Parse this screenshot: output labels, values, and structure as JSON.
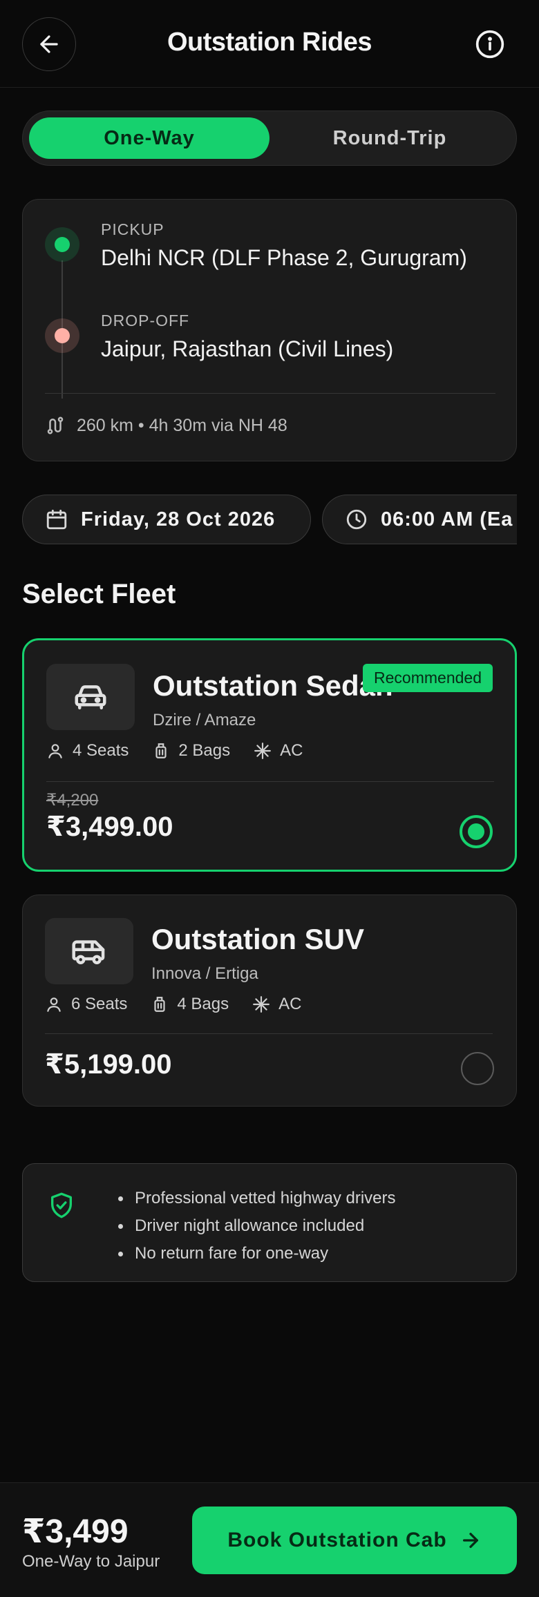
{
  "header": {
    "title": "Outstation Rides",
    "back_icon": "arrow-left-icon",
    "info_icon": "info-icon"
  },
  "trip_type": {
    "options": [
      "One-Way",
      "Round-Trip"
    ],
    "selected": "One-Way"
  },
  "route": {
    "pickup_label": "PICKUP",
    "pickup_value": "Delhi NCR (DLF Phase 2, Gurugram)",
    "dropoff_label": "DROP-OFF",
    "dropoff_value": "Jaipur, Rajasthan (Civil Lines)",
    "summary": "260 km • 4h 30m via NH 48"
  },
  "schedule": {
    "date": "Friday, 28 Oct 2026",
    "time": "06:00 AM (Ea"
  },
  "fleet": {
    "title": "Select Fleet",
    "options": [
      {
        "name": "Outstation Sedan",
        "models": "Dzire / Amaze",
        "badge": "Recommended",
        "seats": "4 Seats",
        "bags": "2 Bags",
        "ac": "AC",
        "old_price": "₹4,200",
        "price": "₹3,499.00",
        "selected": true
      },
      {
        "name": "Outstation SUV",
        "models": "Innova / Ertiga",
        "seats": "6 Seats",
        "bags": "4 Bags",
        "ac": "AC",
        "price": "₹5,199.00",
        "selected": false
      }
    ]
  },
  "info": {
    "items": [
      "Professional vetted highway drivers",
      "Driver night allowance included",
      "No return fare for one-way"
    ]
  },
  "footer": {
    "total": "₹3,499",
    "subtitle": "One-Way to Jaipur",
    "book_label": "Book Outstation Cab"
  },
  "colors": {
    "accent": "#16d16e",
    "background": "#0a0a0a",
    "card": "#1b1b1b",
    "dropoff": "#ffb0a6"
  }
}
